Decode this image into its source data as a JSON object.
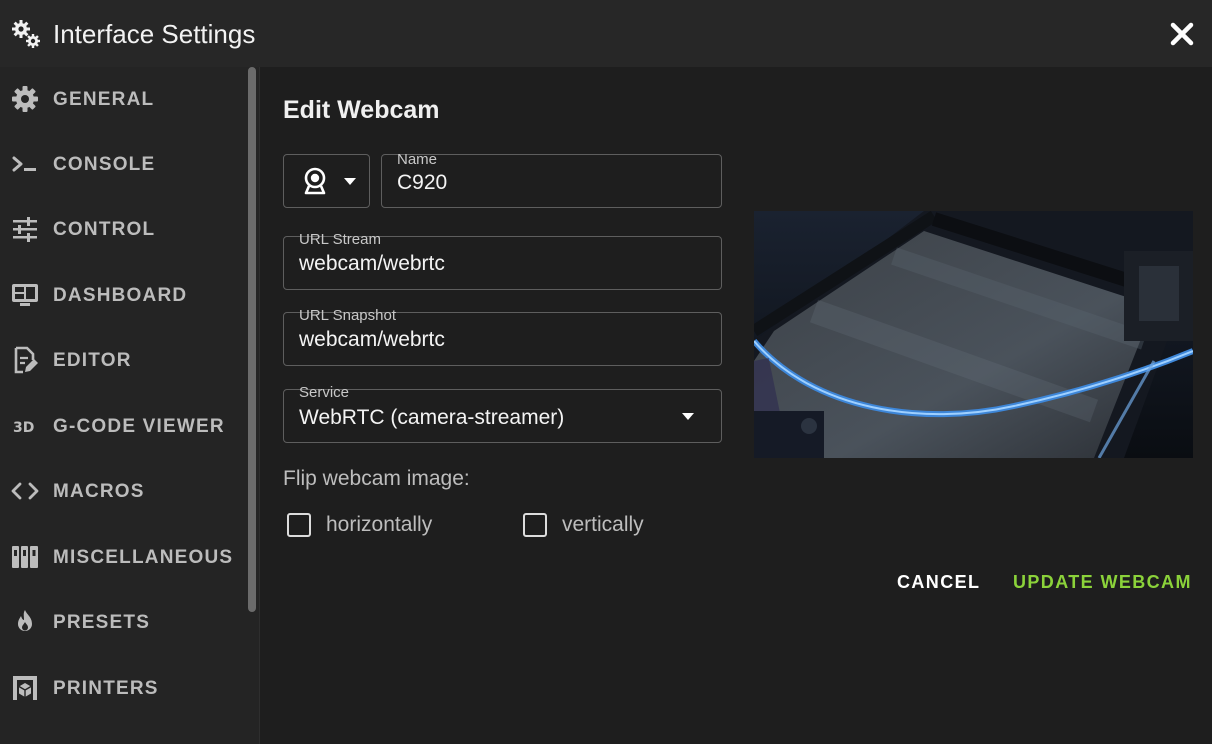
{
  "window": {
    "title": "Interface Settings",
    "title_icon": "cogs-icon",
    "close_icon": "close-icon"
  },
  "sidebar": {
    "items": [
      {
        "label": "GENERAL",
        "icon": "gear-icon"
      },
      {
        "label": "CONSOLE",
        "icon": "console-icon"
      },
      {
        "label": "CONTROL",
        "icon": "tune-icon"
      },
      {
        "label": "DASHBOARD",
        "icon": "monitor-dashboard-icon"
      },
      {
        "label": "EDITOR",
        "icon": "file-edit-icon"
      },
      {
        "label": "G-CODE VIEWER",
        "icon": "3d-icon"
      },
      {
        "label": "MACROS",
        "icon": "code-brackets-icon"
      },
      {
        "label": "MISCELLANEOUS",
        "icon": "miscellaneous-icon"
      },
      {
        "label": "PRESETS",
        "icon": "fire-icon"
      },
      {
        "label": "PRINTERS",
        "icon": "printer-3d-icon"
      }
    ]
  },
  "form": {
    "heading": "Edit Webcam",
    "icon_select": {
      "icon": "webcam-icon"
    },
    "name": {
      "label": "Name",
      "value": "C920"
    },
    "url_stream": {
      "label": "URL Stream",
      "value": "webcam/webrtc"
    },
    "url_snapshot": {
      "label": "URL Snapshot",
      "value": "webcam/webrtc"
    },
    "service": {
      "label": "Service",
      "value": "WebRTC (camera-streamer)"
    },
    "flip": {
      "label": "Flip webcam image:",
      "horizontally": {
        "label": "horizontally",
        "checked": false
      },
      "vertically": {
        "label": "vertically",
        "checked": false
      }
    },
    "buttons": {
      "cancel": "CANCEL",
      "update": "UPDATE WEBCAM"
    }
  },
  "colors": {
    "accent": "#8bd23a",
    "background": "#1e1e1e",
    "titlebar": "#272727",
    "sidebar": "#242424"
  }
}
